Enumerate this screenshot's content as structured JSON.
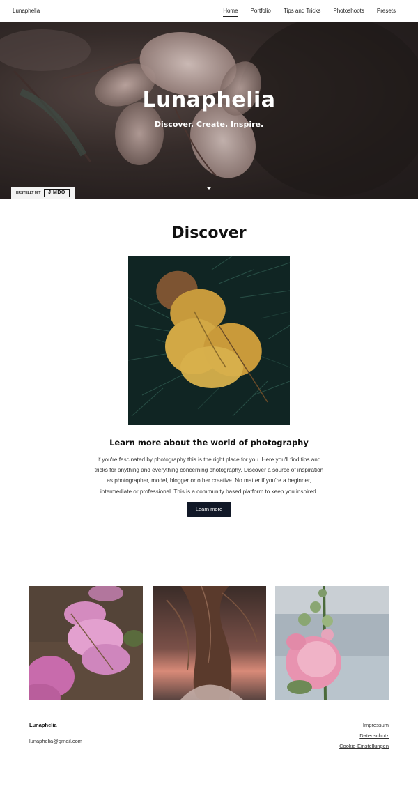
{
  "header": {
    "logo": "Lunaphelia",
    "nav": [
      "Home",
      "Portfolio",
      "Tips and Tricks",
      "Photoshoots",
      "Presets"
    ],
    "active": "Home"
  },
  "hero": {
    "title": "Lunaphelia",
    "subtitle": "Discover. Create. Inspire.",
    "scroll_icon": "caret-down-icon",
    "badge_label": "ERSTELLT MIT",
    "badge_brand": "JIMDO"
  },
  "discover": {
    "title": "Discover",
    "subtitle": "Learn more about the world of photography",
    "paragraph": "If you're fascinated by photography this is the right place for you. Here you'll find tips and tricks for anything and everything concerning photography. Discover a source of inspiration as photographer, model, blogger or other creative. No matter if you're a beginner, intermediate or professional. This is a community based platform to keep you inspired.",
    "button_label": "Learn more"
  },
  "colors": {
    "button_bg": "#111827",
    "text_dark": "#111111"
  },
  "footer": {
    "brand": "Lunaphelia",
    "email": "lunaphelia@gmail.com",
    "links": [
      "Impressum",
      "Datenschutz",
      "Cookie-Einstellungen"
    ]
  }
}
